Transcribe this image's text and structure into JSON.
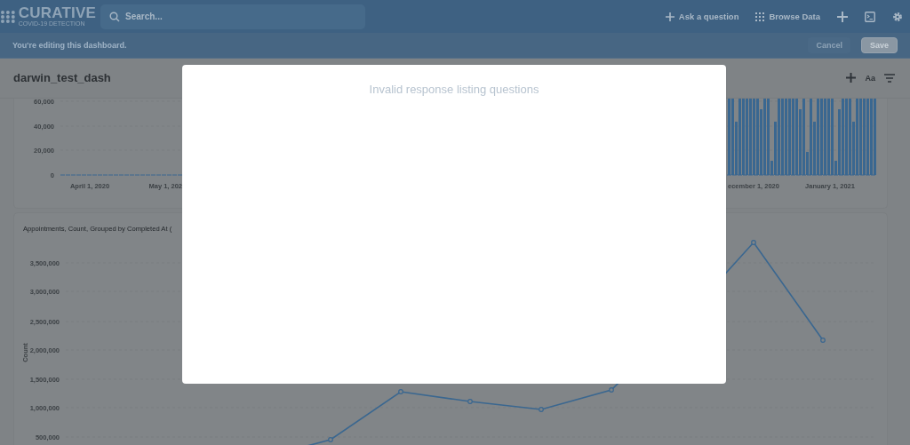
{
  "nav": {
    "logo": {
      "name": "CURATIVE",
      "tagline": "COVID-19 DETECTION"
    },
    "search": {
      "placeholder": "Search..."
    },
    "actions": [
      {
        "label": "Ask a question",
        "kind": "plus"
      },
      {
        "label": "Browse Data",
        "kind": "grid"
      }
    ]
  },
  "edit_bar": {
    "message": "You're editing this dashboard.",
    "buttons": [
      {
        "label": "Cancel",
        "kind": "secondary"
      },
      {
        "label": "Save",
        "kind": "primary"
      }
    ]
  },
  "dashboard": {
    "title": "darwin_test_dash",
    "text_button": "Aa"
  },
  "bar_card": {
    "y_labels": [
      "60,000",
      "40,000",
      "20,000",
      "0"
    ],
    "x_labels": [
      "April 1, 2020",
      "May 1, 202",
      "ecember 1, 2020",
      "January 1, 2021"
    ]
  },
  "line_card": {
    "title": "Appointments, Count, Grouped by Completed At (",
    "y_axis_title": "Count",
    "y_labels": [
      "3,500,000",
      "3,000,000",
      "2,500,000",
      "2,000,000",
      "1,500,000",
      "1,000,000",
      "500,000"
    ]
  },
  "modal": {
    "message": "Invalid response listing questions"
  }
}
